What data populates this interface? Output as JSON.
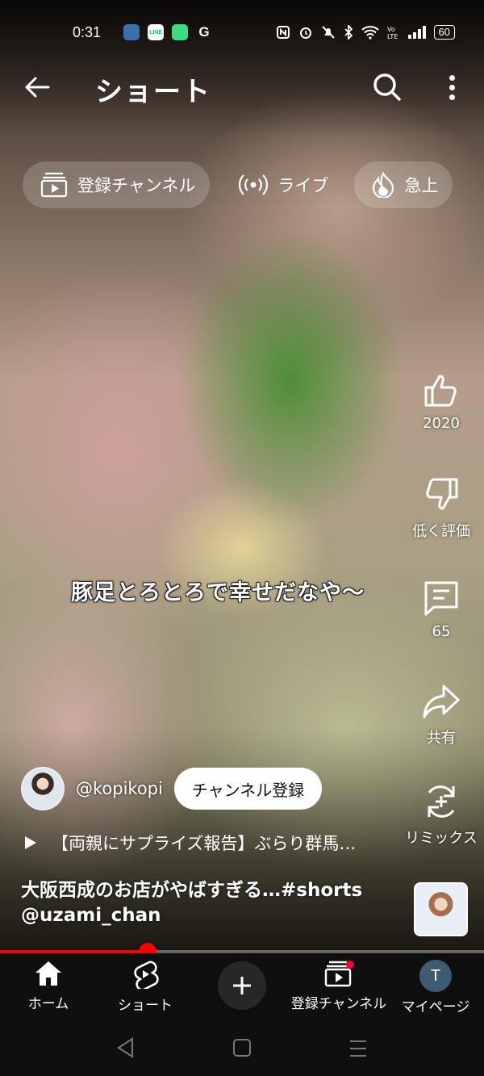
{
  "status_bar": {
    "time": "0:31",
    "apps": [
      {
        "name": "app-avatar",
        "color": "#3b6fb0",
        "text": ""
      },
      {
        "name": "line",
        "color": "#ffffff",
        "text": "LINE"
      },
      {
        "name": "messaging",
        "color": "#3ddc84",
        "text": ""
      },
      {
        "name": "google",
        "color": "#ffffff",
        "text": "G"
      }
    ],
    "battery": "60"
  },
  "header": {
    "title": "ショート"
  },
  "chips": [
    {
      "label": "登録チャンネル",
      "icon": "subscriptions-icon"
    },
    {
      "label": "ライブ",
      "icon": "live-icon"
    },
    {
      "label": "急上",
      "icon": "trending-icon"
    }
  ],
  "caption": "豚足とろとろで幸せだなや〜",
  "actions": {
    "like": {
      "label": "2020"
    },
    "dislike": {
      "label": "低く評価"
    },
    "comments": {
      "label": "65"
    },
    "share": {
      "label": "共有"
    },
    "remix": {
      "label": "リミックス"
    }
  },
  "channel": {
    "name": "@kopikopi",
    "subscribe_label": "チャンネル登録"
  },
  "related_video": "【両親にサプライズ報告】ぶらり群馬…",
  "video": {
    "title_line1": "大阪西成のお店がやばすぎる…#shorts",
    "title_line2": "@uzami_chan",
    "progress": 0.305
  },
  "bottom_nav": {
    "home": "ホーム",
    "shorts": "ショート",
    "subscriptions": "登録チャンネル",
    "you": "マイページ",
    "you_initial": "T"
  },
  "colors": {
    "accent": "#ff0000",
    "nav_bg": "#0f0f0f"
  }
}
